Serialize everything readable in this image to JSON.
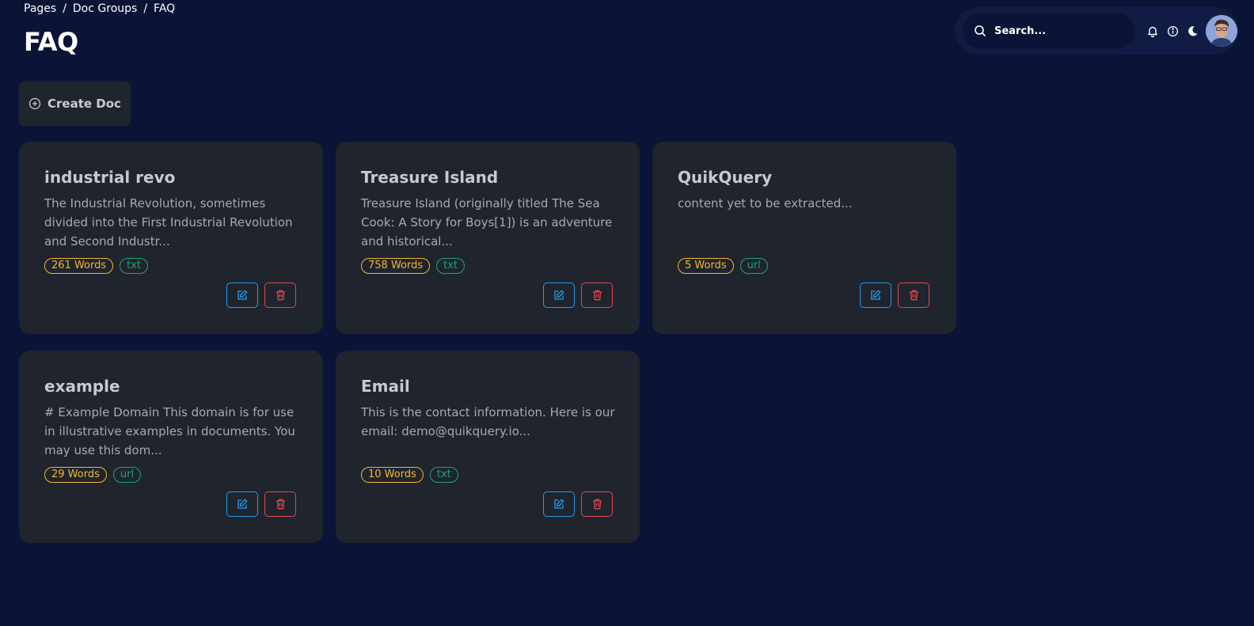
{
  "breadcrumb": {
    "items": [
      "Pages",
      "Doc Groups",
      "FAQ"
    ],
    "separator": "/"
  },
  "page": {
    "title": "FAQ"
  },
  "search": {
    "placeholder": "Search..."
  },
  "toolbar": {
    "create_label": "Create Doc"
  },
  "cards": [
    {
      "title": "industrial revo",
      "description": "The Industrial Revolution, sometimes divided into the First Industrial Revolution and Second Industr...",
      "words": "261 Words",
      "type": "txt"
    },
    {
      "title": "Treasure Island",
      "description": "Treasure Island (originally titled The Sea Cook: A Story for Boys[1]) is an adventure and historical...",
      "words": "758 Words",
      "type": "txt"
    },
    {
      "title": "QuikQuery",
      "description": "content yet to be extracted...",
      "words": "5 Words",
      "type": "url"
    },
    {
      "title": "example",
      "description": "# Example Domain This domain is for use in illustrative examples in documents. You may use this dom...",
      "words": "29 Words",
      "type": "url"
    },
    {
      "title": "Email",
      "description": "This is the contact information. Here is our email: demo@quikquery.io...",
      "words": "10 Words",
      "type": "txt"
    }
  ],
  "icons": {
    "search": "search-icon",
    "bell": "bell-icon",
    "info": "info-icon",
    "theme": "moon-icon",
    "create": "plus-circle-icon",
    "edit": "edit-icon",
    "delete": "trash-icon"
  },
  "colors": {
    "background": "#0b1437",
    "card": "#1f242d",
    "words_badge": "#f4b72a",
    "type_badge": "#1ea672",
    "edit": "#1da1f2",
    "delete": "#e5484d"
  }
}
